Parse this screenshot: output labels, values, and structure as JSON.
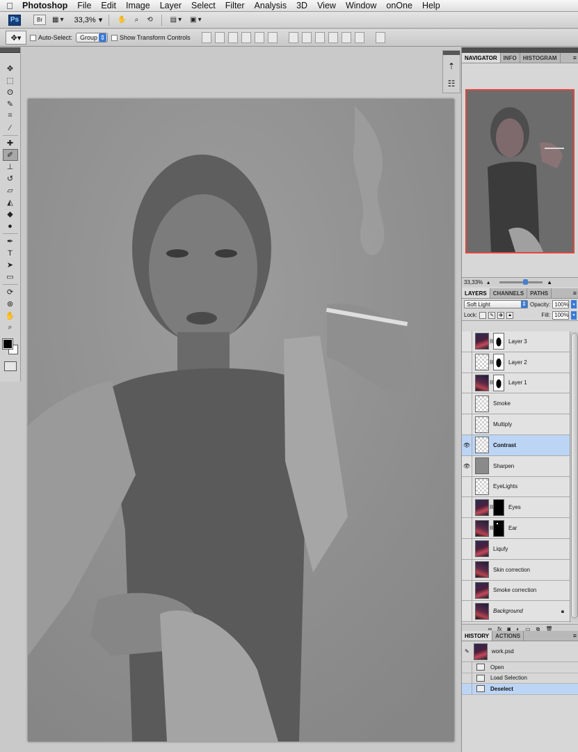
{
  "menubar": {
    "apple": "",
    "app_name": "Photoshop",
    "items": [
      "File",
      "Edit",
      "Image",
      "Layer",
      "Select",
      "Filter",
      "Analysis",
      "3D",
      "View",
      "Window",
      "onOne",
      "Help"
    ]
  },
  "appbar": {
    "ps_logo": "Ps",
    "br_logo": "Br",
    "zoom": "33,3%"
  },
  "options": {
    "auto_select_label": "Auto-Select:",
    "auto_select_value": "Group",
    "show_transform_label": "Show Transform Controls"
  },
  "tools": [
    "move-tool",
    "marquee-tool",
    "lasso-tool",
    "quick-select-tool",
    "crop-tool",
    "eyedropper-tool",
    "healing-tool",
    "brush-tool",
    "stamp-tool",
    "history-brush-tool",
    "eraser-tool",
    "gradient-tool",
    "blur-tool",
    "dodge-tool",
    "pen-tool",
    "type-tool",
    "path-select-tool",
    "shape-tool",
    "3d-rotate-tool",
    "3d-orbit-tool",
    "hand-tool",
    "zoom-tool"
  ],
  "navigator": {
    "tabs": [
      "NAVIGATOR",
      "INFO",
      "HISTOGRAM"
    ],
    "zoom": "33,33%"
  },
  "layers": {
    "tabs": [
      "LAYERS",
      "CHANNELS",
      "PATHS"
    ],
    "blend_mode": "Soft Light",
    "opacity_label": "Opacity:",
    "opacity": "100%",
    "lock_label": "Lock:",
    "fill_label": "Fill:",
    "fill": "100%",
    "items": [
      {
        "name": "Layer 3",
        "visible": false,
        "thumb": "photo",
        "mask": "silh"
      },
      {
        "name": "Layer 2",
        "visible": false,
        "thumb": "checker",
        "mask": "silh"
      },
      {
        "name": "Layer 1",
        "visible": false,
        "thumb": "photo2",
        "mask": "silh"
      },
      {
        "name": "Smoke",
        "visible": false,
        "thumb": "checker",
        "mask": ""
      },
      {
        "name": "Multiply",
        "visible": false,
        "thumb": "checker",
        "mask": ""
      },
      {
        "name": "Contrast",
        "visible": true,
        "thumb": "checker",
        "mask": "",
        "selected": true
      },
      {
        "name": "Sharpen",
        "visible": true,
        "thumb": "grey",
        "mask": ""
      },
      {
        "name": "EyeLights",
        "visible": false,
        "thumb": "checker",
        "mask": ""
      },
      {
        "name": "Eyes",
        "visible": false,
        "thumb": "photo",
        "mask": "black"
      },
      {
        "name": "Ear",
        "visible": false,
        "thumb": "photo2",
        "mask": "dot"
      },
      {
        "name": "Liqufy",
        "visible": false,
        "thumb": "photo",
        "mask": ""
      },
      {
        "name": "Skin correction",
        "visible": false,
        "thumb": "photo2",
        "mask": ""
      },
      {
        "name": "Smoke correction",
        "visible": false,
        "thumb": "photo",
        "mask": ""
      },
      {
        "name": "Background",
        "visible": false,
        "thumb": "photo2",
        "mask": "",
        "locked": true
      }
    ]
  },
  "history": {
    "tabs": [
      "HISTORY",
      "ACTIONS"
    ],
    "snapshot": "work.psd",
    "items": [
      "Open",
      "Load Selection",
      "Deselect"
    ]
  },
  "colors": {
    "accent": "#3a7ad6",
    "selection": "#bcd5f5",
    "navigator_frame": "#e3453d"
  }
}
